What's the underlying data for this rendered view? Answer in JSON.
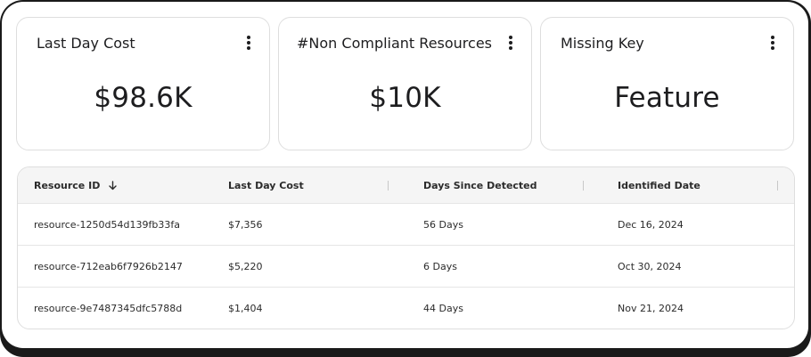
{
  "cards": [
    {
      "title": "Last Day Cost",
      "value": "$98.6K"
    },
    {
      "title": "#Non Compliant Resources",
      "value": "$10K"
    },
    {
      "title": "Missing Key",
      "value": "Feature"
    }
  ],
  "table": {
    "columns": [
      "Resource ID",
      "Last Day Cost",
      "Days Since Detected",
      "Identified Date"
    ],
    "sort_icon": "arrow-down-icon",
    "rows": [
      [
        "resource-1250d54d139fb33fa",
        "$7,356",
        "56 Days",
        "Dec 16, 2024"
      ],
      [
        "resource-712eab6f7926b2147",
        "$5,220",
        "6 Days",
        "Oct 30, 2024"
      ],
      [
        "resource-9e7487345dfc5788d",
        "$1,404",
        "44 Days",
        "Nov 21, 2024"
      ]
    ]
  },
  "icons": {
    "card_menu": "vertical-dots-icon"
  }
}
